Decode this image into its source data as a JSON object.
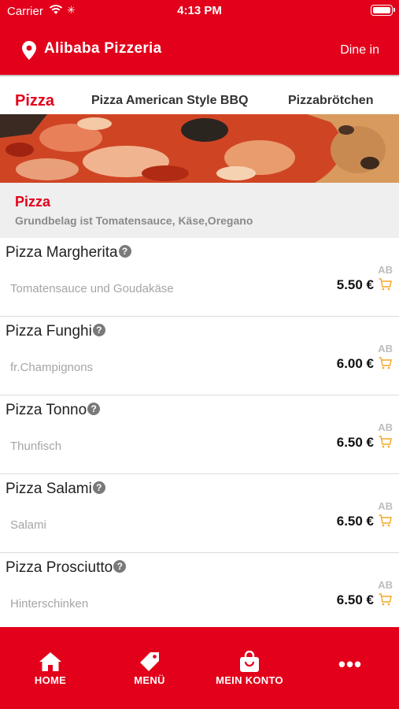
{
  "status_bar": {
    "carrier": "Carrier",
    "time": "4:13 PM",
    "wifi_icon": "wifi-icon",
    "battery_icon": "battery-icon"
  },
  "header": {
    "title": "Alibaba Pizzeria",
    "location_icon": "map-pin-icon",
    "mode": "Dine in",
    "brand_color": "#e2001a"
  },
  "category_tabs": [
    {
      "label": "Pizza",
      "active": true
    },
    {
      "label": "Pizza American Style BBQ",
      "active": false
    },
    {
      "label": "Pizzabrötchen",
      "active": false
    }
  ],
  "category": {
    "title": "Pizza",
    "subtitle": "Grundbelag ist Tomatensauce, Käse,Oregano"
  },
  "items": [
    {
      "name": "Pizza Margherita",
      "description": "Tomatensauce und Goudakäse",
      "price_prefix": "AB",
      "price": "5.50 €"
    },
    {
      "name": "Pizza Funghi",
      "description": "fr.Champignons",
      "price_prefix": "AB",
      "price": "6.00 €"
    },
    {
      "name": "Pizza Tonno",
      "description": "Thunfisch",
      "price_prefix": "AB",
      "price": "6.50 €"
    },
    {
      "name": "Pizza Salami",
      "description": "Salami",
      "price_prefix": "AB",
      "price": "6.50 €"
    },
    {
      "name": "Pizza Prosciutto",
      "description": "Hinterschinken",
      "price_prefix": "AB",
      "price": "6.50 €"
    }
  ],
  "info_glyph": "?",
  "tab_bar": {
    "home": {
      "label": "HOME",
      "icon": "home-icon"
    },
    "menu": {
      "label": "MENÜ",
      "icon": "tag-icon"
    },
    "account": {
      "label": "MEIN KONTO",
      "icon": "shopping-bag-icon"
    },
    "more": {
      "label": "•••",
      "icon": "more-icon"
    }
  },
  "colors": {
    "accent": "#e2001a",
    "cart": "#f5a623"
  }
}
